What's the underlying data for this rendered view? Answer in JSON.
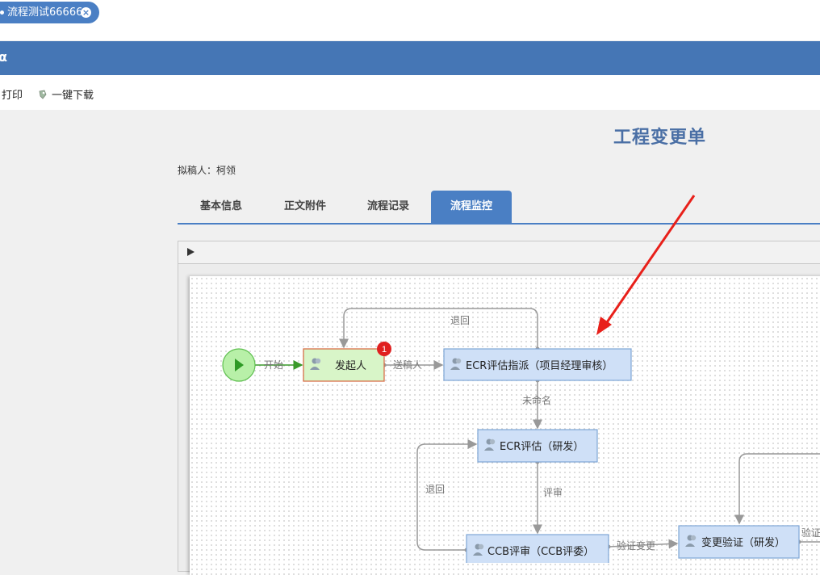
{
  "window_tab": {
    "label": "流程测试66666"
  },
  "header": {
    "title": "α"
  },
  "toolbar": {
    "print_label": "打印",
    "download_label": "一键下载"
  },
  "document": {
    "title": "工程变更单",
    "drafter": "拟稿人：柯领"
  },
  "tabs": [
    {
      "label": "基本信息"
    },
    {
      "label": "正文附件"
    },
    {
      "label": "流程记录"
    },
    {
      "label": "流程监控",
      "active": true
    }
  ],
  "flow": {
    "nodes": {
      "initiator": "发起人",
      "initiator_badge": "1",
      "ecr_assign": "ECR评估指派（项目经理审核）",
      "ecr_eval": "ECR评估（研发）",
      "ccb_review": "CCB评审（CCB评委）",
      "change_verify": "变更验证（研发）"
    },
    "edges": {
      "start": "开始",
      "send_draft": "送稿人",
      "return1": "退回",
      "unnamed": "未命名",
      "review": "评审",
      "return2": "退回",
      "verify_change": "验证变更",
      "verify_cut": "验证"
    }
  },
  "colors": {
    "accent": "#4a7fc4",
    "header_bar": "#4576b5",
    "start_node": "#b8f0a8",
    "initiator_fill": "#d8f5c8",
    "initiator_border": "#d9704a",
    "task_fill": "#cfe0f7",
    "task_border": "#7fa6d6",
    "badge": "#e02020",
    "arrow": "#e8201a"
  }
}
